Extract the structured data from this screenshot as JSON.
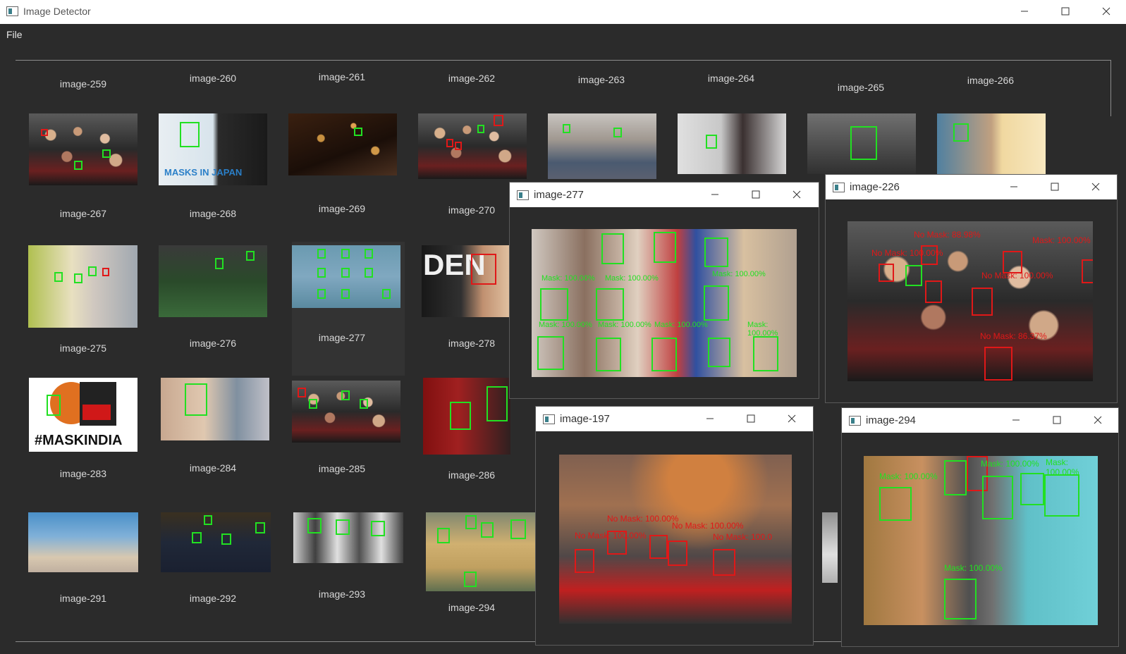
{
  "app": {
    "title": "Image Detector",
    "menu": {
      "file": "File"
    }
  },
  "window_controls": {
    "minimize": "minimize-icon",
    "maximize": "maximize-icon",
    "close": "close-icon"
  },
  "colors": {
    "mask_box": "#22e022",
    "no_mask_box": "#e01818",
    "background": "#2b2b2b",
    "titlebar": "#ffffff"
  },
  "gallery": {
    "row1": [
      "image-259",
      "image-260",
      "image-261",
      "image-262",
      "image-263",
      "image-264",
      "image-265",
      "image-266"
    ],
    "row2": [
      "image-267",
      "image-268",
      "image-269",
      "image-270"
    ],
    "row3": [
      "image-275",
      "image-276",
      "image-277",
      "image-278"
    ],
    "row4": [
      "image-283",
      "image-284",
      "image-285",
      "image-286"
    ],
    "row5": [
      "image-291",
      "image-292",
      "image-293",
      "image-294"
    ]
  },
  "thumb_texts": {
    "masks_in_japan": "MASKS IN JAPAN",
    "maskindia": "#MASKINDIA",
    "den": "DEN"
  },
  "windows": {
    "w277": {
      "title": "image-277",
      "labels": [
        "Mask: 100.00%",
        "Mask: 100.00%",
        "Mask: 100.00%",
        "Mask: 100.00%",
        "Mask: 100.00%",
        "Mask: 100.00%",
        "Mask: 100.00%"
      ]
    },
    "w226": {
      "title": "image-226",
      "labels": [
        "No Mask: 88.98%",
        "Mask: 100.00%",
        "No Mask: 100.00%",
        "No Mask: 100.00%",
        "No Mask: 86.37%"
      ]
    },
    "w197": {
      "title": "image-197",
      "labels": [
        "No Mask: 100.00%",
        "No Mask: 100.00%",
        "No Mask: 100.00%",
        "No Mask: 100.0"
      ]
    },
    "w294": {
      "title": "image-294",
      "labels": [
        "Mask: 100.00%",
        "Mask: 100.00%",
        "Mask: 100.00%",
        "Mask: 100.00%"
      ]
    }
  }
}
